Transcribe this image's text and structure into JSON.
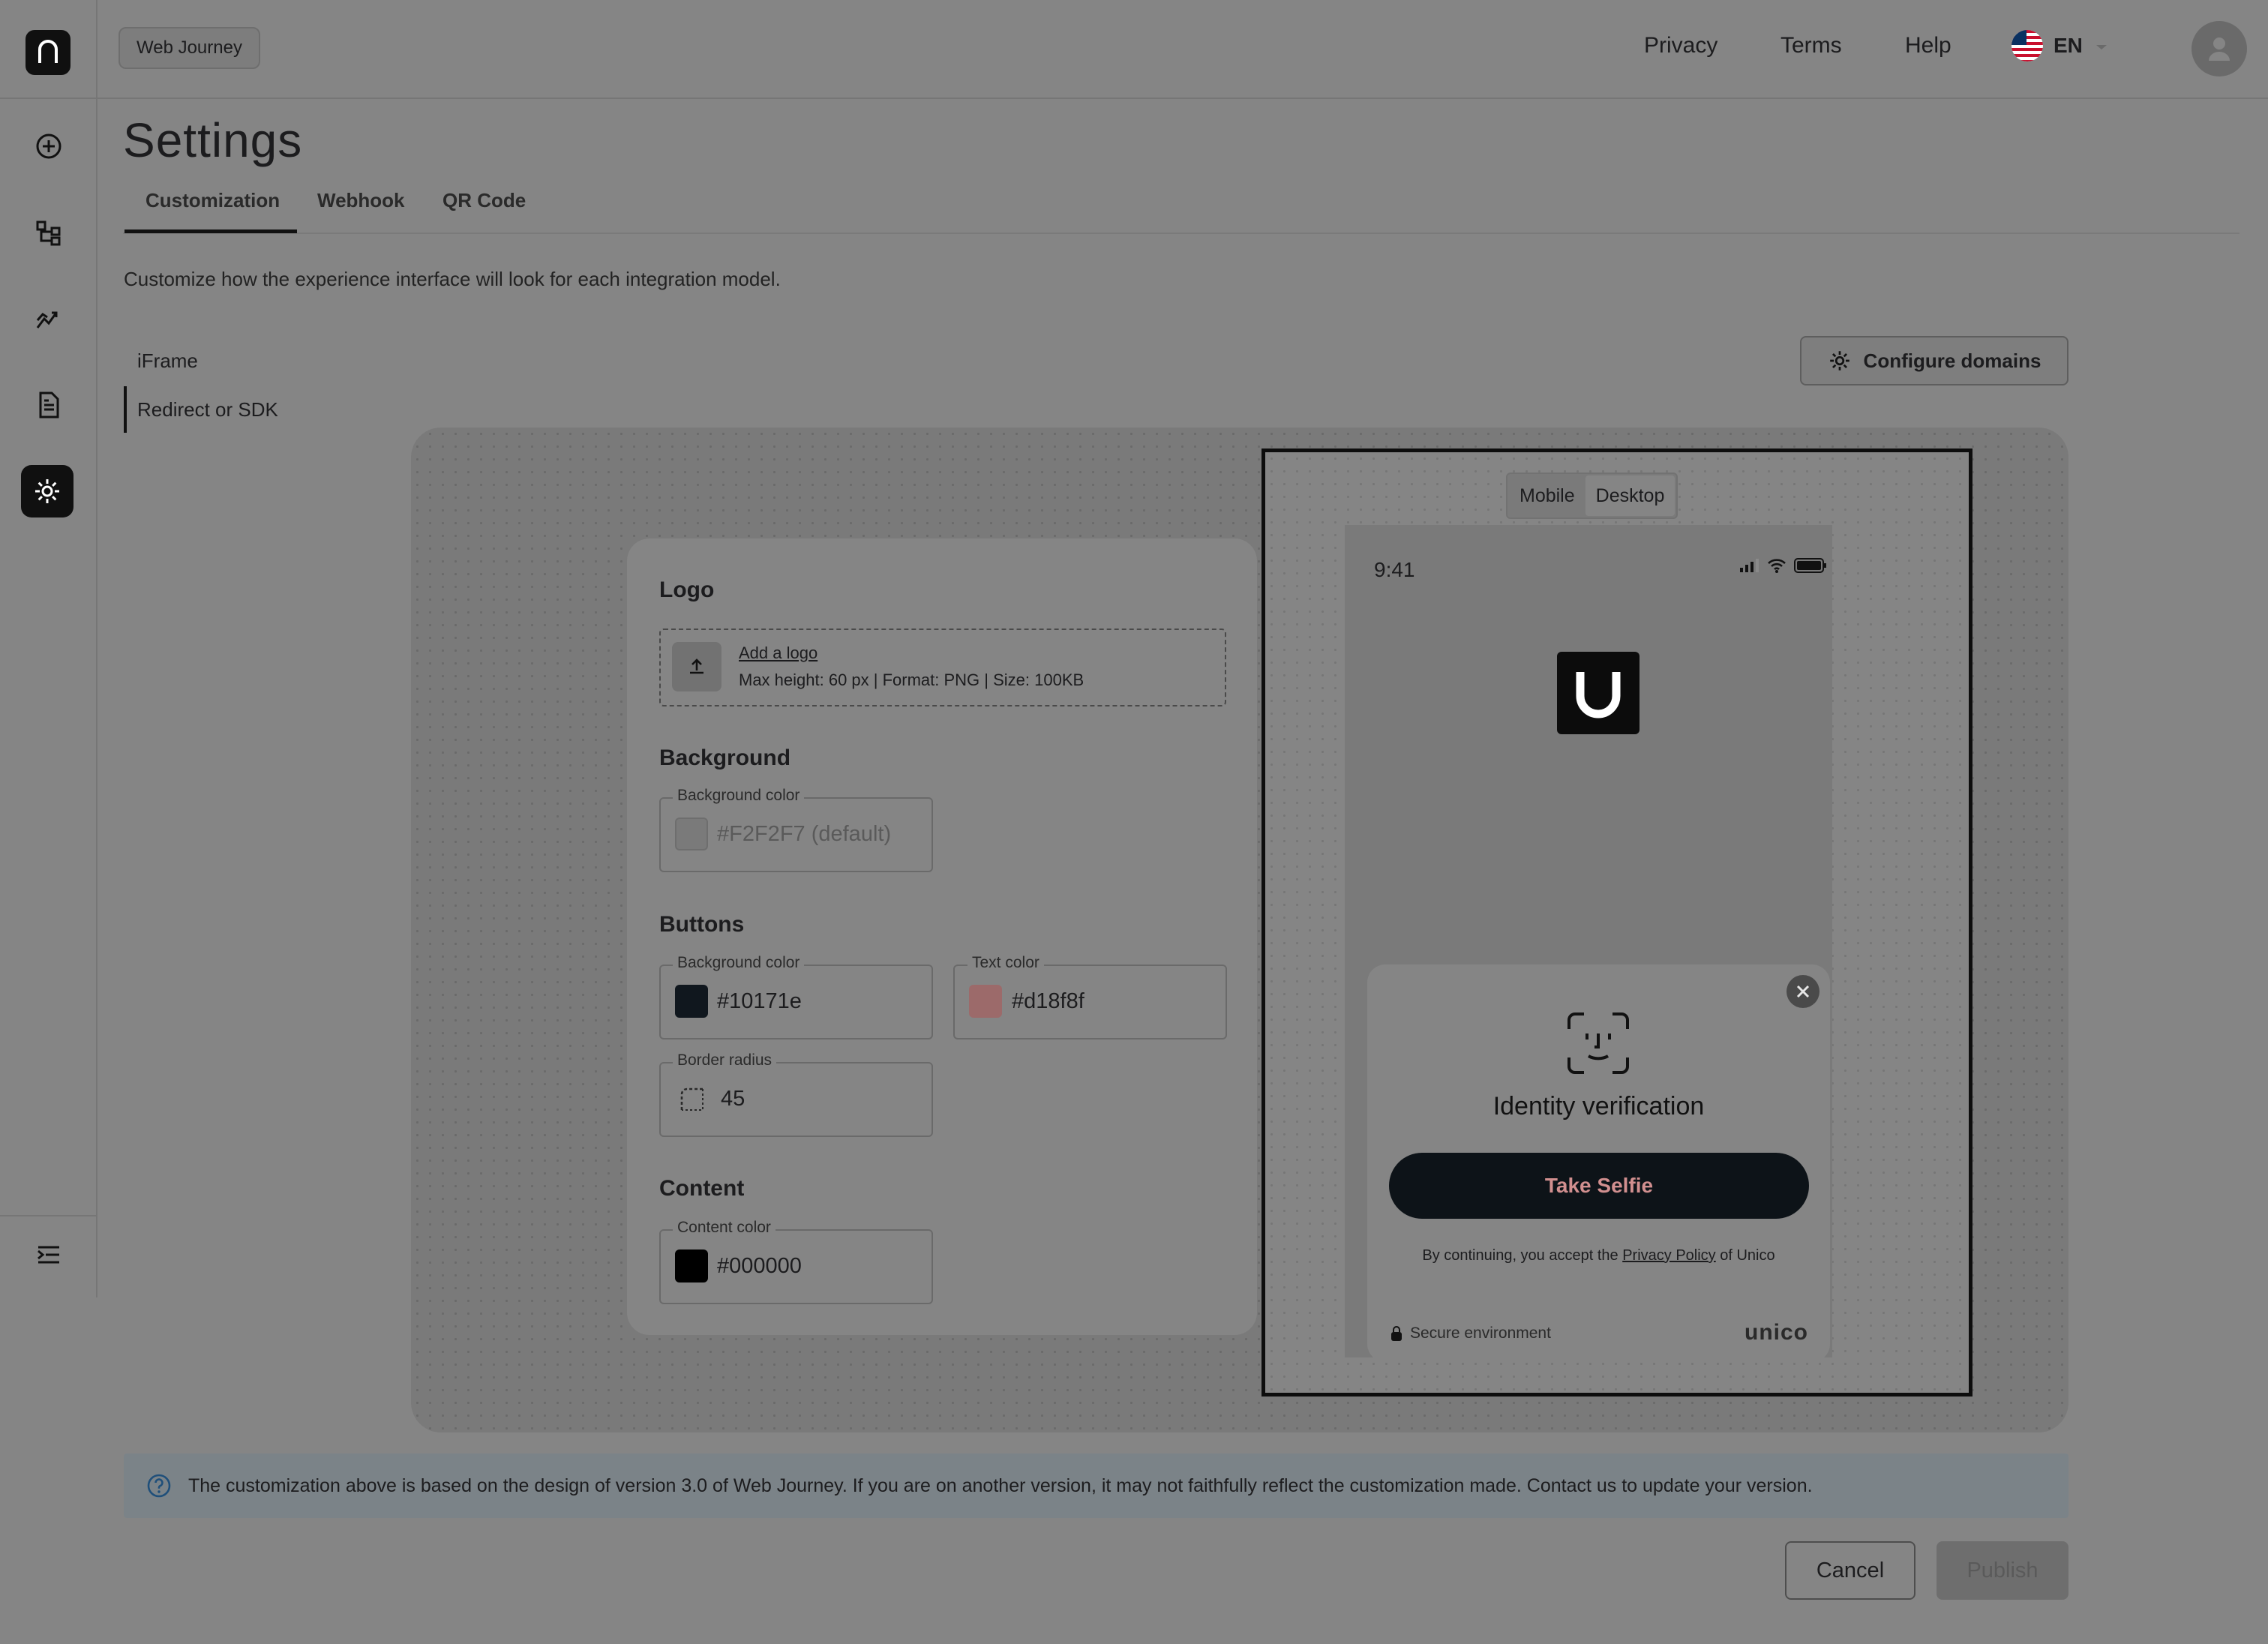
{
  "header": {
    "journey_chip": "Web Journey",
    "links": {
      "privacy": "Privacy",
      "terms": "Terms",
      "help": "Help"
    },
    "language": "EN"
  },
  "sidebar": {
    "icons": [
      "plus-circle-icon",
      "workflow-icon",
      "analytics-icon",
      "document-icon",
      "settings-icon",
      "collapse-menu-icon"
    ],
    "active": "settings-icon"
  },
  "page": {
    "title": "Settings",
    "tabs": [
      {
        "label": "Customization",
        "active": true
      },
      {
        "label": "Webhook",
        "active": false
      },
      {
        "label": "QR Code",
        "active": false
      }
    ],
    "description": "Customize how the experience interface will look for each integration model."
  },
  "integrations": {
    "items": [
      {
        "label": "iFrame",
        "active": false
      },
      {
        "label": "Redirect or SDK",
        "active": true
      }
    ],
    "configure_button": "Configure domains"
  },
  "form": {
    "logo": {
      "title": "Logo",
      "add_link": "Add a logo",
      "hint": "Max height: 60 px | Format: PNG | Size: 100KB"
    },
    "background": {
      "title": "Background",
      "color_label": "Background color",
      "color_value": "#F2F2F7 (default)",
      "swatch": "#7a7a7a"
    },
    "buttons": {
      "title": "Buttons",
      "bg_label": "Background color",
      "bg_value": "#10171e",
      "bg_swatch": "#10171e",
      "text_label": "Text color",
      "text_value": "#d18f8f",
      "text_swatch": "#9c6a6a",
      "radius_label": "Border radius",
      "radius_value": "45"
    },
    "content": {
      "title": "Content",
      "color_label": "Content color",
      "color_value": "#000000",
      "swatch": "#000000"
    }
  },
  "preview": {
    "device_options": [
      "Mobile",
      "Desktop"
    ],
    "selected_device": "Desktop",
    "clock": "9:41",
    "sheet_title": "Identity verification",
    "selfie_button": "Take Selfie",
    "consent_prefix": "By continuing, you accept the ",
    "consent_link": "Privacy Policy",
    "consent_suffix": " of Unico",
    "secure_text": "Secure environment",
    "brand": "unico"
  },
  "info_banner": "The customization above is based on the design of version 3.0 of Web Journey. If you are on another version, it may not faithfully reflect the customization made. Contact us to update your version.",
  "footer": {
    "cancel": "Cancel",
    "publish": "Publish"
  },
  "colors": {
    "accent_dark": "#101010",
    "button_bg": "#10171e",
    "button_text": "#d18f8f"
  }
}
